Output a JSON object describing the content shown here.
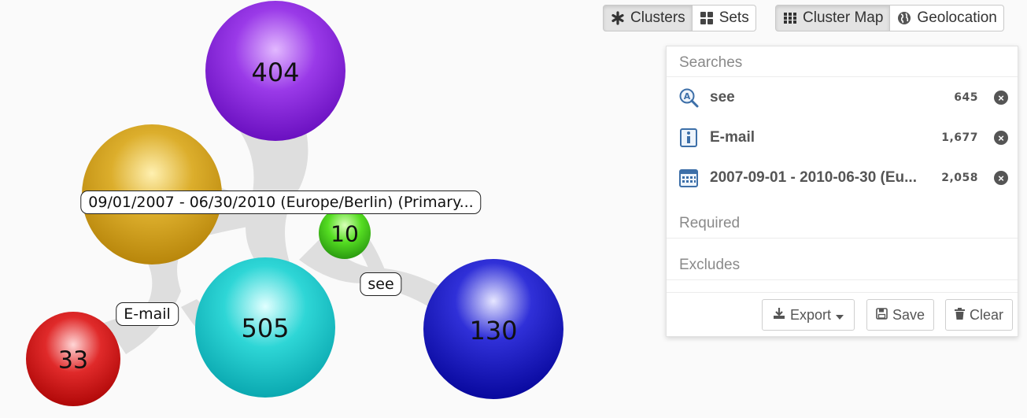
{
  "toolbar": {
    "view_group": [
      {
        "label": "Clusters",
        "icon": "asterisk-icon",
        "active": true
      },
      {
        "label": "Sets",
        "icon": "grid-squares-icon",
        "active": false
      }
    ],
    "mode_group": [
      {
        "label": "Cluster Map",
        "icon": "grid-dots-icon",
        "active": true
      },
      {
        "label": "Geolocation",
        "icon": "globe-icon",
        "active": false
      }
    ]
  },
  "map": {
    "bubbles": [
      {
        "value": "404",
        "color": "#8a2be2"
      },
      {
        "value": "",
        "color": "#d4a520"
      },
      {
        "value": "10",
        "color": "#44cc22"
      },
      {
        "value": "505",
        "color": "#22cccc"
      },
      {
        "value": "130",
        "color": "#1111bb"
      },
      {
        "value": "33",
        "color": "#dd2222"
      }
    ],
    "tags": {
      "date": "09/01/2007 - 06/30/2010 (Europe/Berlin) (Primary...",
      "see": "see",
      "email": "E-mail"
    }
  },
  "panel": {
    "searches_header": "Searches",
    "searches": [
      {
        "label": "see",
        "count": "645",
        "icon": "text-search-icon"
      },
      {
        "label": "E-mail",
        "count": "1,677",
        "icon": "info-icon"
      },
      {
        "label": "2007-09-01 - 2010-06-30 (Eu...",
        "count": "2,058",
        "icon": "calendar-icon"
      }
    ],
    "required_header": "Required",
    "excludes_header": "Excludes",
    "export_label": "Export",
    "save_label": "Save",
    "clear_label": "Clear"
  }
}
